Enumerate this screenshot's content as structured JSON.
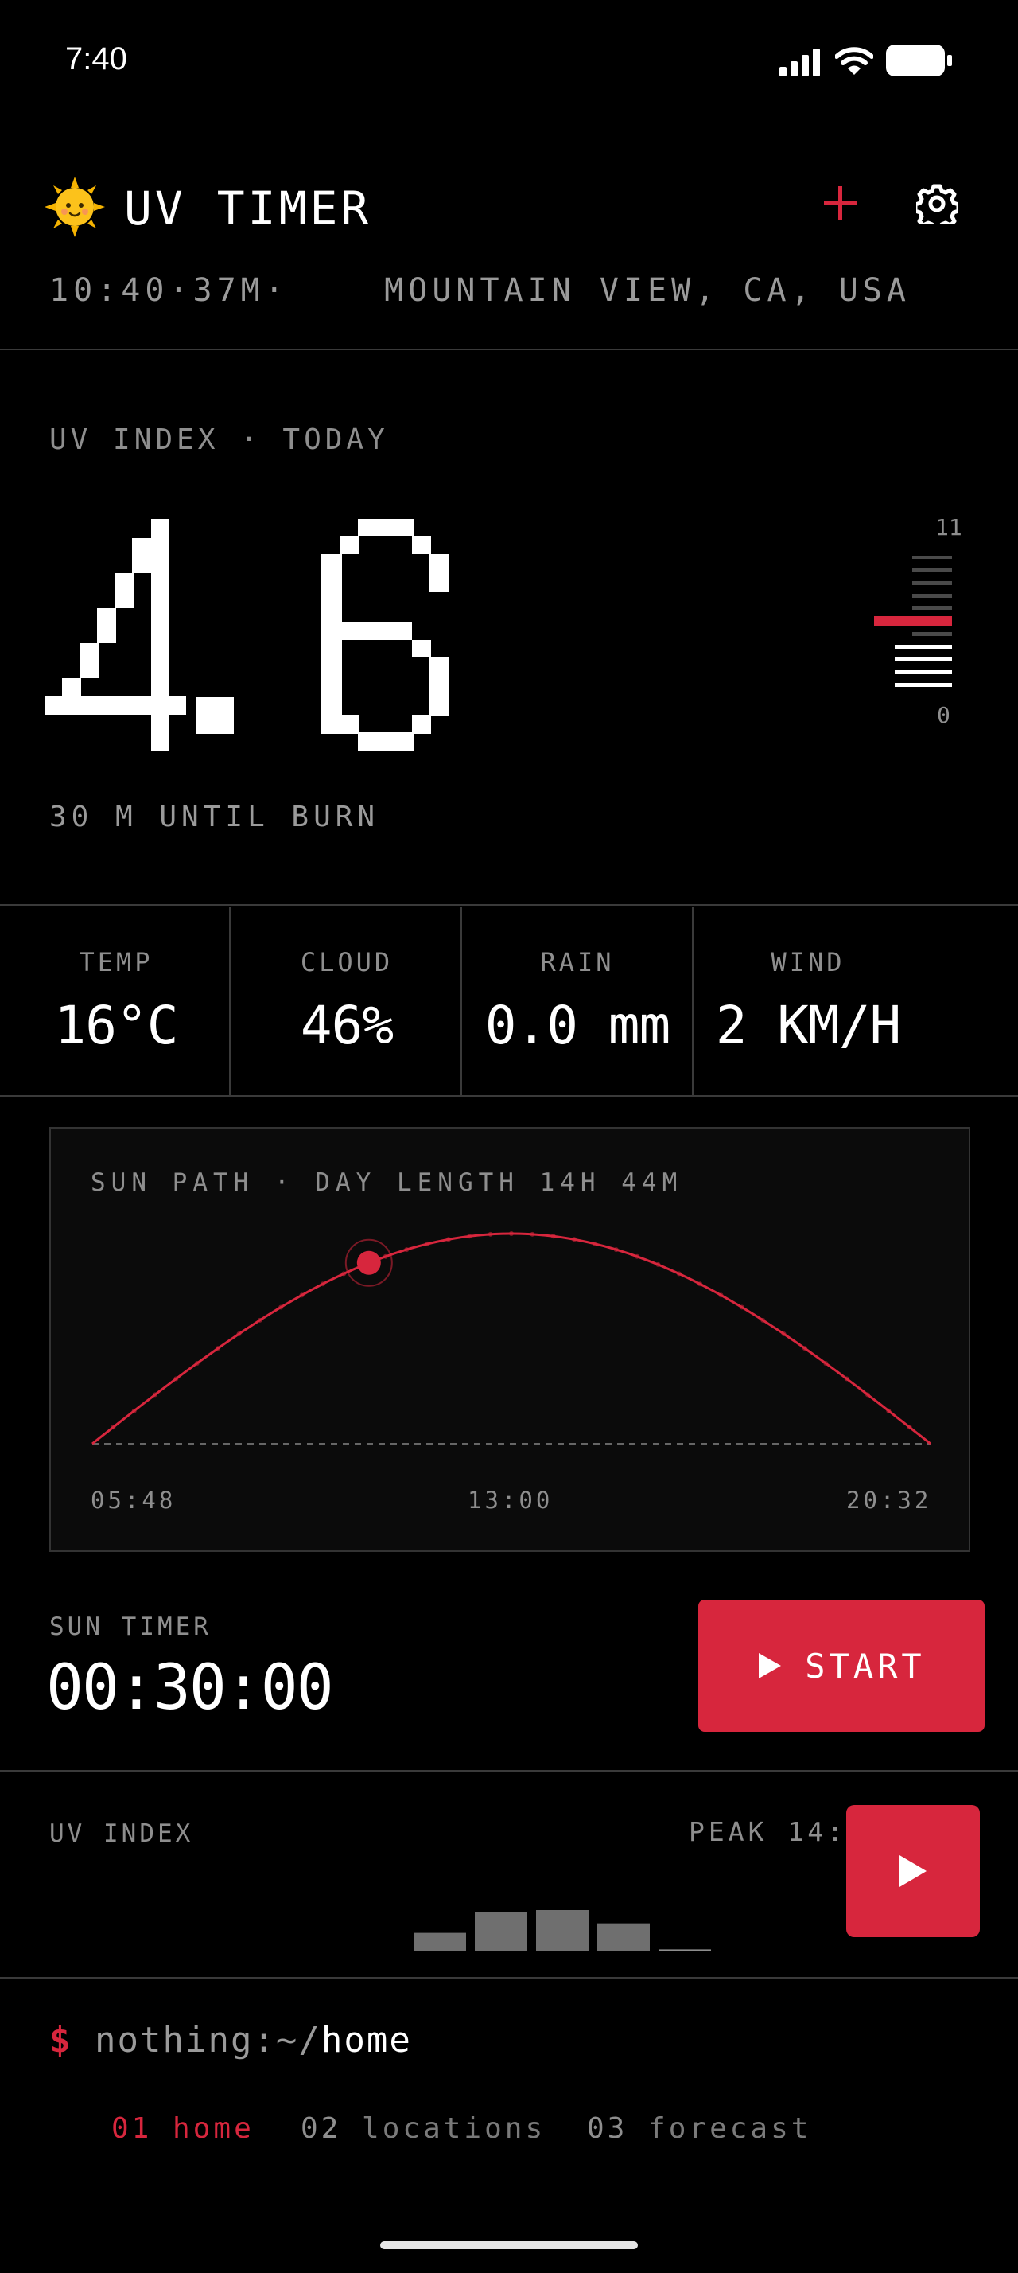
{
  "status_bar": {
    "time": "7:40"
  },
  "header": {
    "title": "UV TIMER",
    "logo_icon": "sun-face-emoji",
    "subtitle_time": "10:40·37M·",
    "location": "MOUNTAIN VIEW, CA, USA",
    "accent": "#d7263d"
  },
  "uv": {
    "label": "UV INDEX · TODAY",
    "value": "4.6",
    "value_number": 4.6,
    "scale_max": "11",
    "scale_min": "0",
    "burn_text": "30 M UNTIL BURN"
  },
  "stats": [
    {
      "label": "TEMP",
      "value": "16°C"
    },
    {
      "label": "CLOUD",
      "value": "46%"
    },
    {
      "label": "RAIN",
      "value": "0.0 mm"
    },
    {
      "label": "WIND",
      "value": "2 KM/H"
    }
  ],
  "sun_path": {
    "title": "SUN PATH · DAY LENGTH 14H 44M",
    "sunrise": "05:48",
    "noon": "13:00",
    "sunset": "20:32",
    "current_position": 0.33
  },
  "timer": {
    "label": "SUN TIMER",
    "value": "00:30:00",
    "start_label": "START"
  },
  "uv_forecast": {
    "label": "UV INDEX",
    "peak": "PEAK 14:0",
    "bars": [
      0.45,
      0.95,
      1.0,
      0.68,
      0.05
    ]
  },
  "terminal": {
    "dollar": "$",
    "prompt_prefix": "nothing:~/",
    "prompt_path": "home",
    "nav": [
      {
        "num": "01",
        "label": "home"
      },
      {
        "num": "02",
        "label": "locations"
      },
      {
        "num": "03",
        "label": "forecast"
      }
    ]
  }
}
